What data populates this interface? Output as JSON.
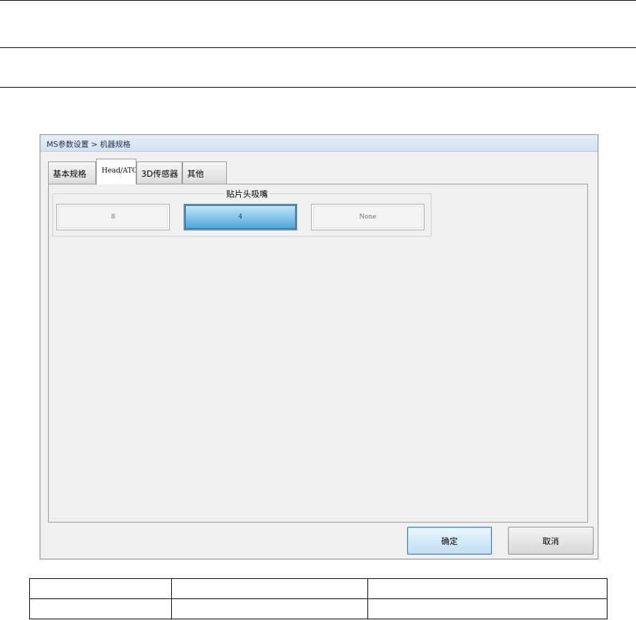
{
  "dialog": {
    "breadcrumb": "MS参数设置 > 机器规格",
    "tabs": [
      {
        "label": "基本规格",
        "active": false
      },
      {
        "label": "Head/ATC",
        "active": true
      },
      {
        "label": "3D传感器",
        "active": false
      },
      {
        "label": "其他",
        "active": false
      }
    ],
    "group": {
      "title": "贴片头吸嘴",
      "options": [
        "8",
        "4",
        "None"
      ],
      "selected": "4"
    },
    "buttons": {
      "ok_label": "确定",
      "cancel_label": "取消"
    }
  },
  "colors": {
    "selected_option": "#5aaee0",
    "titlebar": "#dbe6f3",
    "panel_bg": "#f0f0f0"
  }
}
